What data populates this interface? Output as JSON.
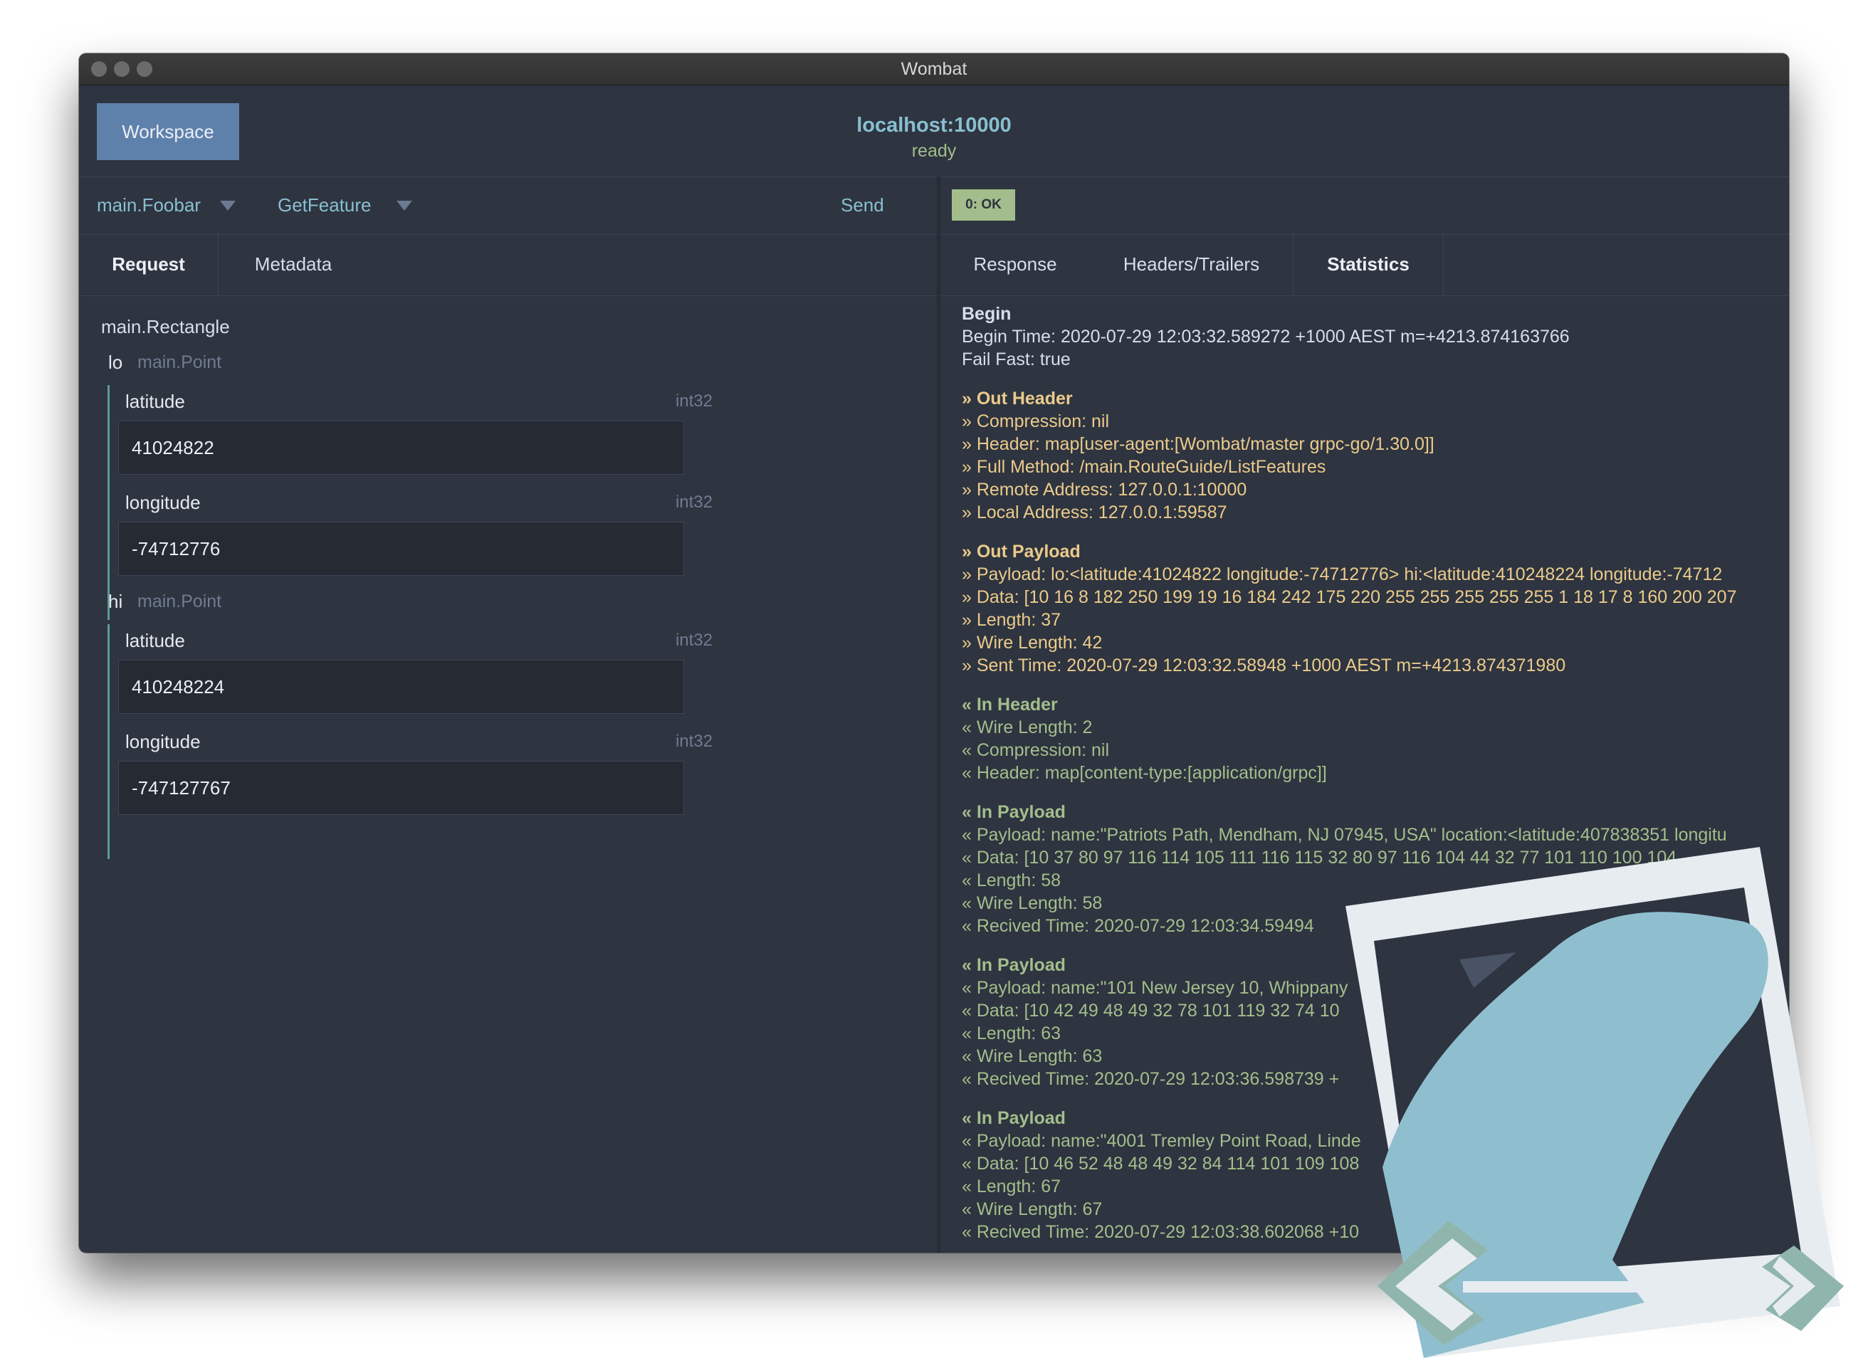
{
  "window": {
    "title": "Wombat"
  },
  "header": {
    "workspace_label": "Workspace",
    "server_address": "localhost:10000",
    "server_status": "ready"
  },
  "request": {
    "service": "main.Foobar",
    "method": "GetFeature",
    "send_label": "Send",
    "tabs": [
      "Request",
      "Metadata"
    ],
    "active_tab": "Request",
    "message_type": "main.Rectangle",
    "groups": [
      {
        "name": "lo",
        "type": "main.Point",
        "fields": [
          {
            "label": "latitude",
            "type": "int32",
            "value": "41024822"
          },
          {
            "label": "longitude",
            "type": "int32",
            "value": "-74712776"
          }
        ]
      },
      {
        "name": "hi",
        "type": "main.Point",
        "fields": [
          {
            "label": "latitude",
            "type": "int32",
            "value": "410248224"
          },
          {
            "label": "longitude",
            "type": "int32",
            "value": "-747127767"
          }
        ]
      }
    ]
  },
  "response": {
    "status": "0: OK",
    "tabs": [
      "Response",
      "Headers/Trailers",
      "Statistics"
    ],
    "active_tab": "Statistics",
    "statistics": [
      {
        "kind": "begin",
        "lines": [
          "Begin",
          "Begin Time: 2020-07-29 12:03:32.589272 +1000 AEST m=+4213.874163766",
          "Fail Fast: true"
        ]
      },
      {
        "kind": "out",
        "lines": [
          "» Out Header",
          "» Compression: nil",
          "» Header: map[user-agent:[Wombat/master grpc-go/1.30.0]]",
          "» Full Method: /main.RouteGuide/ListFeatures",
          "» Remote Address: 127.0.0.1:10000",
          "» Local Address: 127.0.0.1:59587"
        ]
      },
      {
        "kind": "out",
        "lines": [
          "» Out Payload",
          "» Payload: lo:<latitude:41024822 longitude:-74712776> hi:<latitude:410248224 longitude:-74712",
          "» Data: [10 16 8 182 250 199 19 16 184 242 175 220 255 255 255 255 255 1 18 17 8 160 200 207",
          "» Length: 37",
          "» Wire Length: 42",
          "» Sent Time: 2020-07-29 12:03:32.58948 +1000 AEST m=+4213.874371980"
        ]
      },
      {
        "kind": "in",
        "lines": [
          "« In Header",
          "« Wire Length: 2",
          "« Compression: nil",
          "« Header: map[content-type:[application/grpc]]"
        ]
      },
      {
        "kind": "in",
        "lines": [
          "« In Payload",
          "« Payload: name:\"Patriots Path, Mendham, NJ 07945, USA\" location:<latitude:407838351 longitu",
          "« Data: [10 37 80 97 116 114 105 111 116 115 32 80 97 116 104 44 32 77 101 110 100 104",
          "« Length: 58",
          "« Wire Length: 58",
          "« Recived Time: 2020-07-29 12:03:34.59494"
        ]
      },
      {
        "kind": "in",
        "lines": [
          "« In Payload",
          "« Payload: name:\"101 New Jersey 10, Whippany",
          "« Data: [10 42 49 48 49 32 78 101 119 32 74 10",
          "« Length: 63",
          "« Wire Length: 63",
          "« Recived Time: 2020-07-29 12:03:36.598739 +"
        ]
      },
      {
        "kind": "in",
        "lines": [
          "« In Payload",
          "« Payload: name:\"4001 Tremley Point Road, Linde",
          "« Data: [10 46 52 48 48 49 32 84 114 101 109 108",
          "« Length: 67",
          "« Wire Length: 67",
          "« Recived Time: 2020-07-29 12:03:38.602068 +10"
        ]
      }
    ]
  },
  "colors": {
    "background": "#2e3440",
    "accent": "#88c0d0",
    "workspace_button": "#5e81ac",
    "ok_badge": "#a3be8c",
    "outgoing": "#ebcb8b",
    "incoming": "#a3be8c"
  }
}
